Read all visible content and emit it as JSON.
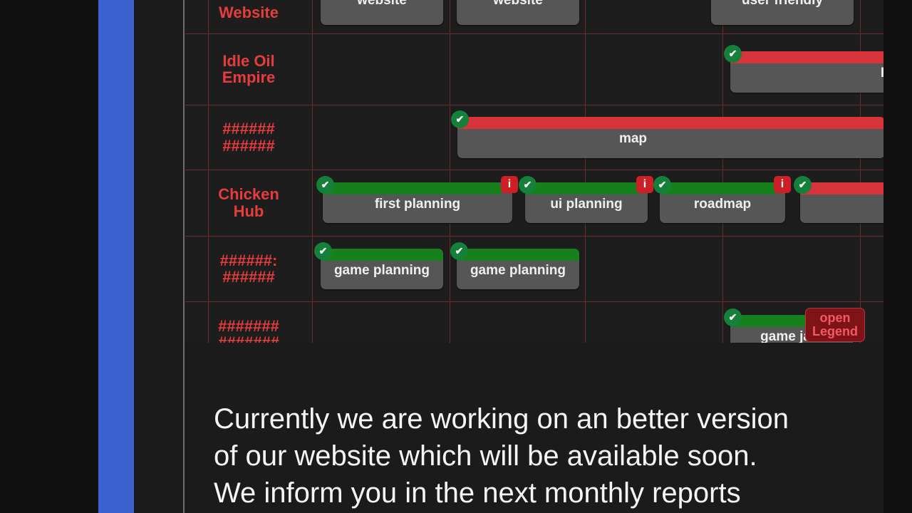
{
  "theme": {
    "page_bg": "#111111",
    "panel_bg": "#1b1b1b",
    "rail_color": "#3b62ce",
    "grid_color": "#6b2b2e",
    "label_color": "#e63c3c",
    "bar_bg": "#565656",
    "fill_green": "#16801c",
    "fill_red": "#d6333a",
    "check_badge_color": "#15803a",
    "info_badge_color": "#cc2026",
    "legend_bg": "#7e1418",
    "legend_text_color": "#f05a60",
    "scrollbar_color": "#cfcbcb"
  },
  "gantt": {
    "rows": [
      {
        "label": "Website",
        "tasks": [
          {
            "text": "website",
            "fill": "green",
            "check": false,
            "info": false
          },
          {
            "text": "website",
            "fill": "green",
            "check": false,
            "info": false
          },
          {
            "text": "user friendly",
            "fill": "green",
            "check": false,
            "info": false
          }
        ]
      },
      {
        "label": "Idle Oil\nEmpire",
        "tasks": [
          {
            "text": "Rew",
            "fill": "red",
            "check": true,
            "info": false
          }
        ]
      },
      {
        "label": "######\n######",
        "tasks": [
          {
            "text": "map",
            "fill": "red",
            "check": true,
            "info": false
          }
        ]
      },
      {
        "label": "Chicken\nHub",
        "tasks": [
          {
            "text": "first planning",
            "fill": "green",
            "check": true,
            "info": true
          },
          {
            "text": "ui planning",
            "fill": "green",
            "check": true,
            "info": true
          },
          {
            "text": "roadmap",
            "fill": "green",
            "check": true,
            "info": true
          },
          {
            "text": "",
            "fill": "red",
            "check": true,
            "info": false
          }
        ]
      },
      {
        "label": "######:\n######",
        "tasks": [
          {
            "text": "game planning",
            "fill": "green",
            "check": true,
            "info": false
          },
          {
            "text": "game planning",
            "fill": "green",
            "check": true,
            "info": false
          }
        ]
      },
      {
        "label": "#######\n#######",
        "tasks": [
          {
            "text": "game jam",
            "fill": "green",
            "check": true,
            "info": false
          }
        ]
      }
    ],
    "legend_tooltip": "open\nLegend",
    "scrollbar_vertical": "vertical-scrollbar",
    "scrollbar_thumb": "vertical-scrollbar-thumb"
  },
  "report": {
    "lines": [
      "Currently we are working on an better version",
      "of our website which will be available soon.",
      "We inform you in the next monthly reports"
    ]
  }
}
